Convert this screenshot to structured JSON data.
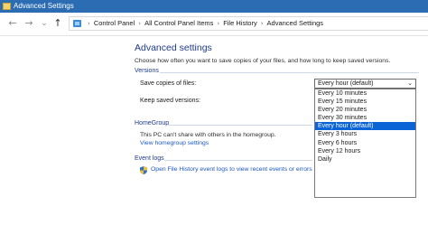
{
  "window": {
    "title": "Advanced Settings"
  },
  "nav": {
    "back": "←",
    "forward": "→",
    "recent": "⌄",
    "up": "↑"
  },
  "breadcrumbs": [
    "Control Panel",
    "All Control Panel Items",
    "File History",
    "Advanced Settings"
  ],
  "page": {
    "title": "Advanced settings",
    "description": "Choose how often you want to save copies of your files, and how long to keep saved versions."
  },
  "versions": {
    "section_label": "Versions",
    "save_copies_label": "Save copies of files:",
    "keep_versions_label": "Keep saved versions:",
    "selected": "Every hour (default)",
    "options": [
      "Every 10 minutes",
      "Every 15 minutes",
      "Every 20 minutes",
      "Every 30 minutes",
      "Every hour (default)",
      "Every 3 hours",
      "Every 6 hours",
      "Every 12 hours",
      "Daily"
    ]
  },
  "homegroup": {
    "section_label": "HomeGroup",
    "text": "This PC can't share with others in the homegroup.",
    "link": "View homegroup settings"
  },
  "event_logs": {
    "section_label": "Event logs",
    "link": "Open File History event logs to view recent events or errors"
  },
  "colors": {
    "titlebar": "#2b6cb3",
    "accent_text": "#1e3a8c",
    "link": "#1a57c4",
    "selected_option": "#0a64d6"
  }
}
